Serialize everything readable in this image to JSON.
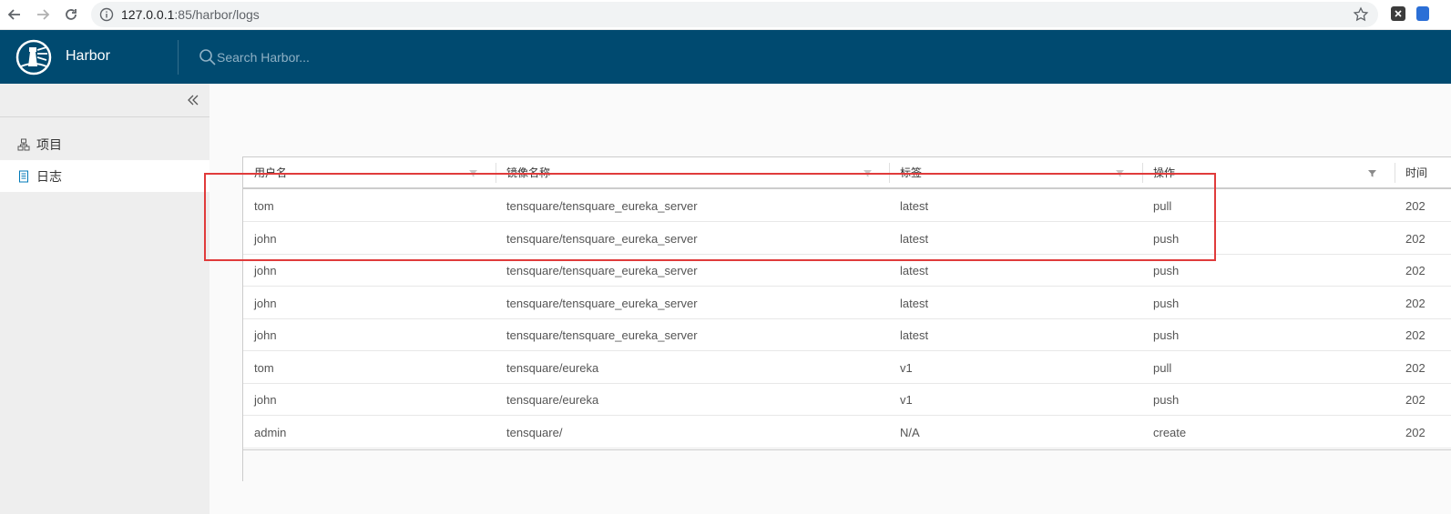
{
  "browser": {
    "url_host": "127.0.0.1",
    "url_rest": ":85/harbor/logs"
  },
  "header": {
    "brand": "Harbor",
    "search_placeholder": "Search Harbor..."
  },
  "sidebar": {
    "items": [
      {
        "label": "项目",
        "icon": "projects-icon"
      },
      {
        "label": "日志",
        "icon": "logs-icon"
      }
    ]
  },
  "grid": {
    "columns": [
      "用户名",
      "镜像名称",
      "标签",
      "操作",
      "时间"
    ],
    "rows": [
      {
        "user": "tom",
        "repo": "tensquare/tensquare_eureka_server",
        "tag": "latest",
        "op": "pull",
        "time": "202"
      },
      {
        "user": "john",
        "repo": "tensquare/tensquare_eureka_server",
        "tag": "latest",
        "op": "push",
        "time": "202"
      },
      {
        "user": "john",
        "repo": "tensquare/tensquare_eureka_server",
        "tag": "latest",
        "op": "push",
        "time": "202"
      },
      {
        "user": "john",
        "repo": "tensquare/tensquare_eureka_server",
        "tag": "latest",
        "op": "push",
        "time": "202"
      },
      {
        "user": "john",
        "repo": "tensquare/tensquare_eureka_server",
        "tag": "latest",
        "op": "push",
        "time": "202"
      },
      {
        "user": "tom",
        "repo": "tensquare/eureka",
        "tag": "v1",
        "op": "pull",
        "time": "202"
      },
      {
        "user": "john",
        "repo": "tensquare/eureka",
        "tag": "v1",
        "op": "push",
        "time": "202"
      },
      {
        "user": "admin",
        "repo": "tensquare/",
        "tag": "N/A",
        "op": "create",
        "time": "202"
      }
    ]
  },
  "colors": {
    "header_bg": "#004a70",
    "highlight": "#e03b3b"
  }
}
